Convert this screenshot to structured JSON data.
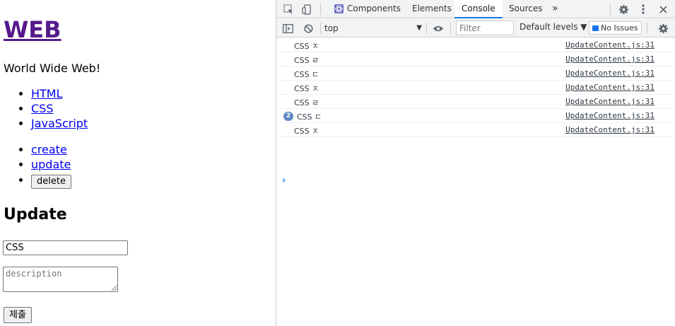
{
  "page": {
    "title": "WEB",
    "tagline": "World Wide Web!",
    "nav_links": [
      "HTML",
      "CSS",
      "JavaScript"
    ],
    "controls": {
      "create": "create",
      "update": "update",
      "delete": "delete"
    },
    "section_title": "Update",
    "form": {
      "title_value": "CSS",
      "description_placeholder": "description",
      "submit_label": "제출"
    }
  },
  "devtools": {
    "tabs": [
      "Components",
      "Elements",
      "Console",
      "Sources"
    ],
    "active_tab": "Console",
    "more_tabs": "»",
    "context": "top",
    "filter_placeholder": "Filter",
    "levels_label": "Default levels ▼",
    "issues_label": "No Issues",
    "logs": [
      {
        "message": "CSS ㅈ",
        "source": "UpdateContent.js:31"
      },
      {
        "message": "CSS ㄹ",
        "source": "UpdateContent.js:31"
      },
      {
        "message": "CSS ㄷ",
        "source": "UpdateContent.js:31"
      },
      {
        "message": "CSS ㅈ",
        "source": "UpdateContent.js:31"
      },
      {
        "message": "CSS ㄹ",
        "source": "UpdateContent.js:31"
      },
      {
        "message": "CSS ㄷ",
        "source": "UpdateContent.js:31",
        "count": "2"
      },
      {
        "message": "CSS ㅈ",
        "source": "UpdateContent.js:31"
      }
    ],
    "prompt": "›",
    "accent_color": "#1a73e8"
  }
}
